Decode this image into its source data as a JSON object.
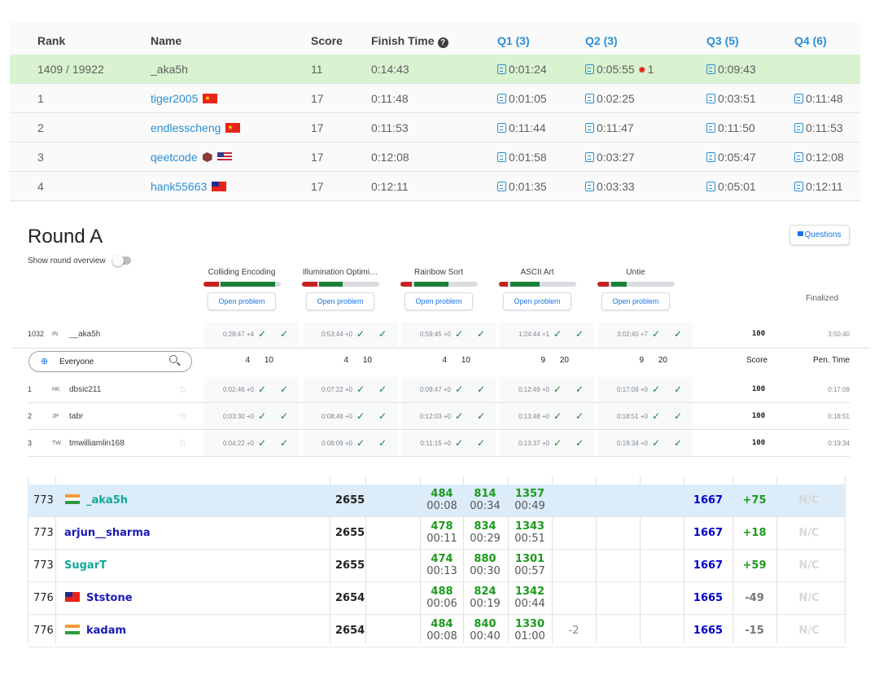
{
  "colors": {
    "lc_blue": "#2a8fd8",
    "lc_highlight": "#d9f2cf",
    "ks_green": "#188038",
    "ks_red": "#c5221f",
    "cf_highlight": "#dcecf9",
    "cf_green": "#1d9a1d",
    "cf_blue": "#0000cc"
  },
  "leaderboard": {
    "headers": {
      "rank": "Rank",
      "name": "Name",
      "score": "Score",
      "finish": "Finish Time",
      "q1": "Q1 (3)",
      "q2": "Q2 (3)",
      "q3": "Q3 (5)",
      "q4": "Q4 (6)"
    },
    "me": {
      "rank": "1409 / 19922",
      "name": "_aka5h",
      "score": "11",
      "finish": "0:14:43",
      "q1": "0:01:24",
      "q2": "0:05:55",
      "q2_wrong": "1",
      "q3": "0:09:43",
      "q4": ""
    },
    "rows": [
      {
        "rank": "1",
        "name": "tiger2005",
        "flag": "cn",
        "score": "17",
        "finish": "0:11:48",
        "q1": "0:01:05",
        "q2": "0:02:25",
        "q3": "0:03:51",
        "q4": "0:11:48"
      },
      {
        "rank": "2",
        "name": "endlesscheng",
        "flag": "cn",
        "score": "17",
        "finish": "0:11:53",
        "q1": "0:11:44",
        "q2": "0:11:47",
        "q3": "0:11:50",
        "q4": "0:11:53"
      },
      {
        "rank": "3",
        "name": "qeetcode",
        "flag": "us",
        "score": "17",
        "finish": "0:12:08",
        "q1": "0:01:58",
        "q2": "0:03:27",
        "q3": "0:05:47",
        "q4": "0:12:08"
      },
      {
        "rank": "4",
        "name": "hank55663",
        "flag": "tw",
        "score": "17",
        "finish": "0:12:11",
        "q1": "0:01:35",
        "q2": "0:03:33",
        "q3": "0:05:01",
        "q4": "0:12:11"
      }
    ]
  },
  "round": {
    "title": "Round A",
    "questions_label": "Questions",
    "overview_label": "Show round overview",
    "finalized_label": "Finalized",
    "open_label": "Open problem",
    "problems": [
      {
        "name": "Colliding Encoding",
        "red": 0.2,
        "green": 0.7,
        "pts_a": "4",
        "pts_b": "10"
      },
      {
        "name": "Illumination Optimi…",
        "red": 0.2,
        "green": 0.3,
        "pts_a": "4",
        "pts_b": "10"
      },
      {
        "name": "Rainbow Sort",
        "red": 0.15,
        "green": 0.45,
        "pts_a": "4",
        "pts_b": "10"
      },
      {
        "name": "ASCII Art",
        "red": 0.12,
        "green": 0.38,
        "pts_a": "9",
        "pts_b": "20"
      },
      {
        "name": "Untie",
        "red": 0.15,
        "green": 0.2,
        "pts_a": "9",
        "pts_b": "20"
      }
    ],
    "me": {
      "rank": "1032",
      "country": "IN",
      "name": "__aka5h",
      "times": [
        "0:28:47 +4",
        "0:53:44 +0",
        "0:59:45 +0",
        "1:24:44 +1",
        "3:02:40 +7"
      ],
      "score": "100",
      "penalty": "3:50:40"
    },
    "filter_label": "Everyone",
    "score_header": "Score",
    "penalty_header": "Pen. Time",
    "rows": [
      {
        "rank": "1",
        "country": "HK",
        "name": "dbsic211",
        "times": [
          "0:02:46 +0",
          "0:07:22 +0",
          "0:09:47 +0",
          "0:12:49 +0",
          "0:17:09 +0"
        ],
        "score": "100",
        "penalty": "0:17:09"
      },
      {
        "rank": "2",
        "country": "JP",
        "name": "tabr",
        "times": [
          "0:03:30 +0",
          "0:08:48 +0",
          "0:12:03 +0",
          "0:13:48 +0",
          "0:18:51 +0"
        ],
        "score": "100",
        "penalty": "0:18:51"
      },
      {
        "rank": "3",
        "country": "TW",
        "name": "tmwilliamlin168",
        "times": [
          "0:04:22 +0",
          "0:08:09 +0",
          "0:11:15 +0",
          "0:13:37 +0",
          "0:19:34 +0"
        ],
        "score": "100",
        "penalty": "0:19:34"
      }
    ]
  },
  "standings": {
    "rows": [
      {
        "rank": "773",
        "flag": "in",
        "handle": "_aka5h",
        "handle_color": "#14a89a",
        "points": "2655",
        "a": [
          "484",
          "00:08"
        ],
        "b": [
          "814",
          "00:34"
        ],
        "c": [
          "1357",
          "00:49"
        ],
        "hack": "",
        "rating": "1667",
        "delta": "+75",
        "delta_color": "#1d9a1d",
        "nc": "N/C",
        "me": true
      },
      {
        "rank": "773",
        "flag": "",
        "handle": "arjun__sharma",
        "handle_color": "#1a1ab8",
        "points": "2655",
        "a": [
          "478",
          "00:11"
        ],
        "b": [
          "834",
          "00:29"
        ],
        "c": [
          "1343",
          "00:51"
        ],
        "hack": "",
        "rating": "1667",
        "delta": "+18",
        "delta_color": "#1d9a1d",
        "nc": "N/C",
        "me": false
      },
      {
        "rank": "773",
        "flag": "",
        "handle": "SugarT",
        "handle_color": "#14a89a",
        "points": "2655",
        "a": [
          "474",
          "00:13"
        ],
        "b": [
          "880",
          "00:30"
        ],
        "c": [
          "1301",
          "00:57"
        ],
        "hack": "",
        "rating": "1667",
        "delta": "+59",
        "delta_color": "#1d9a1d",
        "nc": "N/C",
        "me": false
      },
      {
        "rank": "776",
        "flag": "tw",
        "handle": "Ststone",
        "handle_color": "#1a1ab8",
        "points": "2654",
        "a": [
          "488",
          "00:06"
        ],
        "b": [
          "824",
          "00:19"
        ],
        "c": [
          "1342",
          "00:44"
        ],
        "hack": "",
        "rating": "1665",
        "delta": "-49",
        "delta_color": "#777777",
        "nc": "N/C",
        "me": false
      },
      {
        "rank": "776",
        "flag": "in",
        "handle": "kadam",
        "handle_color": "#1a1ab8",
        "points": "2654",
        "a": [
          "484",
          "00:08"
        ],
        "b": [
          "840",
          "00:40"
        ],
        "c": [
          "1330",
          "01:00"
        ],
        "hack": "-2",
        "rating": "1665",
        "delta": "-15",
        "delta_color": "#777777",
        "nc": "N/C",
        "me": false
      }
    ]
  }
}
